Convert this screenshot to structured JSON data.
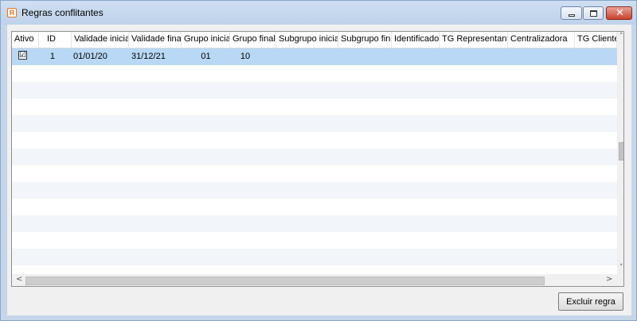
{
  "window": {
    "title": "Regras conflitantes",
    "app_icon_glyph": "R",
    "close_glyph": "✕"
  },
  "table": {
    "columns": [
      {
        "key": "ativo",
        "label": "Ativo"
      },
      {
        "key": "id",
        "label": "ID"
      },
      {
        "key": "validade_inicial",
        "label": "Validade inicial"
      },
      {
        "key": "validade_final",
        "label": "Validade final"
      },
      {
        "key": "grupo_inicial",
        "label": "Grupo inicial"
      },
      {
        "key": "grupo_final",
        "label": "Grupo final"
      },
      {
        "key": "subgrupo_inicial",
        "label": "Subgrupo inicial"
      },
      {
        "key": "subgrupo_final",
        "label": "Subgrupo final"
      },
      {
        "key": "identificador",
        "label": "Identificador"
      },
      {
        "key": "tg_representante",
        "label": "TG Representante"
      },
      {
        "key": "centralizadora",
        "label": "Centralizadora"
      },
      {
        "key": "tg_cliente",
        "label": "TG Cliente"
      }
    ],
    "rows": [
      {
        "ativo": true,
        "ativo_glyph": "☑",
        "id": "1",
        "validade_inicial": "01/01/20",
        "validade_final": "31/12/21",
        "grupo_inicial": "01",
        "grupo_final": "10",
        "subgrupo_inicial": "",
        "subgrupo_final": "",
        "identificador": "",
        "tg_representante": "",
        "centralizadora": "",
        "tg_cliente": ""
      }
    ],
    "selected_row": 0
  },
  "scrollbars": {
    "up_arrow": "˄",
    "down_arrow": "˅",
    "left_arrow": "<",
    "right_arrow": ">"
  },
  "actions": {
    "delete_rule_label": "Excluir regra"
  },
  "colors": {
    "selection": "#b9d8f5",
    "title_bar": "#c5d6ea",
    "close_button": "#c8432d"
  }
}
